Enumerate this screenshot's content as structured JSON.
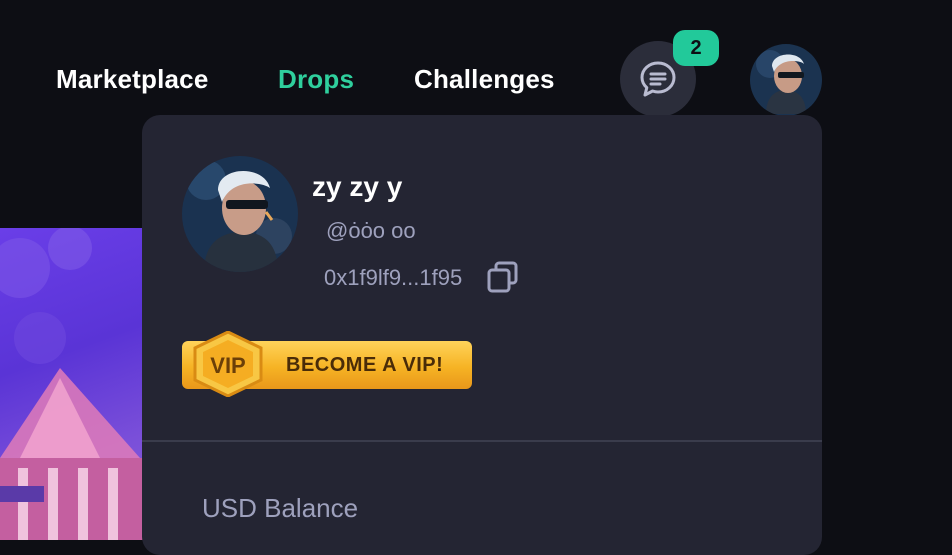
{
  "nav": {
    "marketplace": "Marketplace",
    "drops": "Drops",
    "challenges": "Challenges"
  },
  "chat": {
    "badge_count": "2",
    "icon": "chat-bubble-icon"
  },
  "profile": {
    "display_name": "zy zy y",
    "handle": "@ȯȯo oo",
    "wallet": "0x1f9lf9...1f95"
  },
  "vip": {
    "label": "BECOME A VIP!",
    "emblem": "VIP"
  },
  "balance": {
    "label": "USD Balance"
  },
  "colors": {
    "accent": "#2fcf9d",
    "badge": "#22c99a",
    "panel": "#242533",
    "background": "#0d0e14",
    "vip_gold": "#f6b324"
  }
}
